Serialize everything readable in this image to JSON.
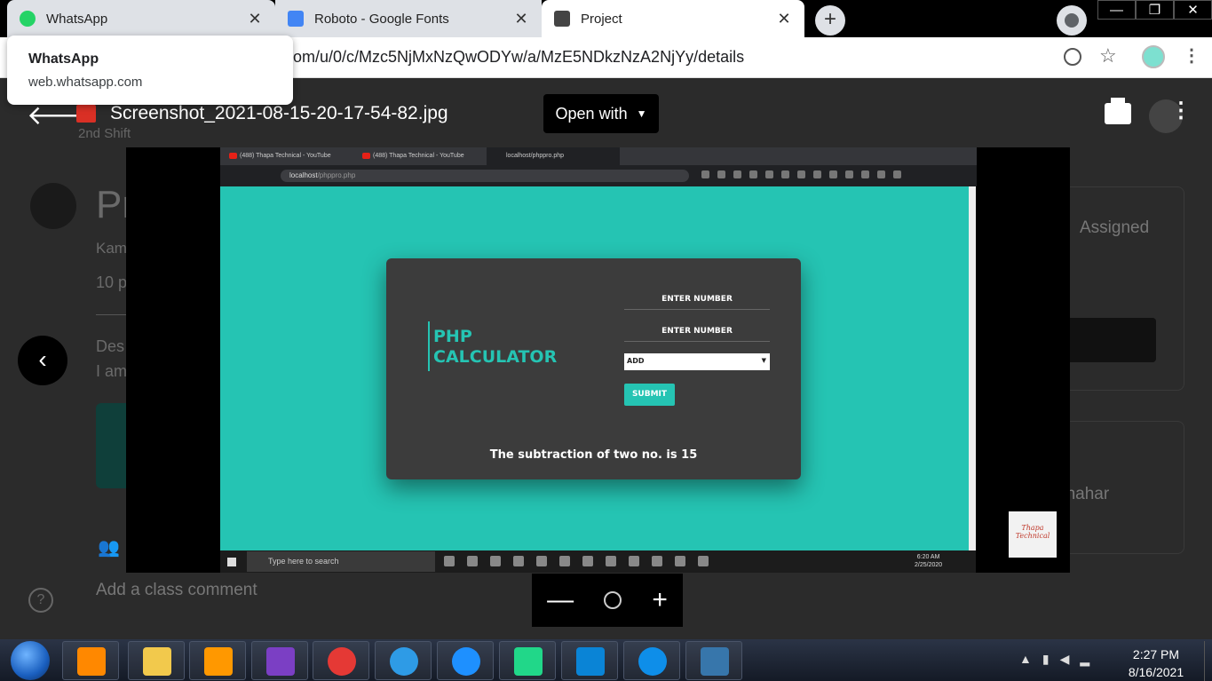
{
  "browser": {
    "tabs": [
      {
        "label": "WhatsApp",
        "icon": "whatsapp-icon",
        "color": "#25d366"
      },
      {
        "label": "Roboto - Google Fonts",
        "icon": "google-fonts-icon",
        "color": "#4285f4"
      },
      {
        "label": "Project",
        "icon": "classroom-icon",
        "color": "#444444"
      }
    ],
    "close_glyph": "✕",
    "new_tab_glyph": "+",
    "url": "om/u/0/c/Mzc5NjMxNzQwODYw/a/MzE5NDkzNzA2NjYy/details",
    "hover_card": {
      "title": "WhatsApp",
      "domain": "web.whatsapp.com"
    }
  },
  "viewer": {
    "filename": "Screenshot_2021-08-15-20-17-54-82.jpg",
    "subtitle": "2nd Shift",
    "open_with": "Open with",
    "zoom_minus": "—",
    "zoom_plus": "+"
  },
  "background_page": {
    "title_fragment": "Pr",
    "author_fragment": "Kam",
    "points_fragment": "10 p",
    "desc_fragment": "Des",
    "line_fragment": "I am",
    "assigned": "Assigned",
    "name_fragment": "nnahar",
    "comment": "Add a class comment"
  },
  "inner_screenshot": {
    "tabs": [
      "(488) Thapa Technical - YouTube",
      "(488) Thapa Technical - YouTube",
      "localhost/phppro.php"
    ],
    "url_host": "localhost",
    "url_path": "/phppro.php",
    "calc_title_line1": "PHP",
    "calc_title_line2": "CALCULATOR",
    "enter1": "ENTER NUMBER",
    "enter2": "ENTER NUMBER",
    "select_value": "ADD",
    "submit": "SUBMIT",
    "result": "The subtraction of two no. is 15",
    "search_placeholder": "Type here to search",
    "time": "6:20 AM",
    "date": "2/25/2020",
    "accent": "#25c4b3"
  },
  "watermark": {
    "line1": "Thapa",
    "line2": "Technical"
  },
  "taskbar": {
    "apps": [
      {
        "name": "vlc-icon",
        "color": "#ff8800"
      },
      {
        "name": "file-explorer-icon",
        "color": "#f2c94c"
      },
      {
        "name": "sublime-text-icon",
        "color": "#ff9800"
      },
      {
        "name": "visual-studio-icon",
        "color": "#7b3fc4"
      },
      {
        "name": "chrome-icon",
        "color": "#e53935"
      },
      {
        "name": "edge-icon",
        "color": "#2e9be6"
      },
      {
        "name": "ie-icon",
        "color": "#1e90ff"
      },
      {
        "name": "pycharm-icon",
        "color": "#21d789"
      },
      {
        "name": "vscode-icon",
        "color": "#0a84d6"
      },
      {
        "name": "teamviewer-icon",
        "color": "#0e8ee9"
      },
      {
        "name": "python-icon",
        "color": "#3776ab"
      }
    ],
    "clock_time": "2:27 PM",
    "clock_date": "8/16/2021"
  }
}
